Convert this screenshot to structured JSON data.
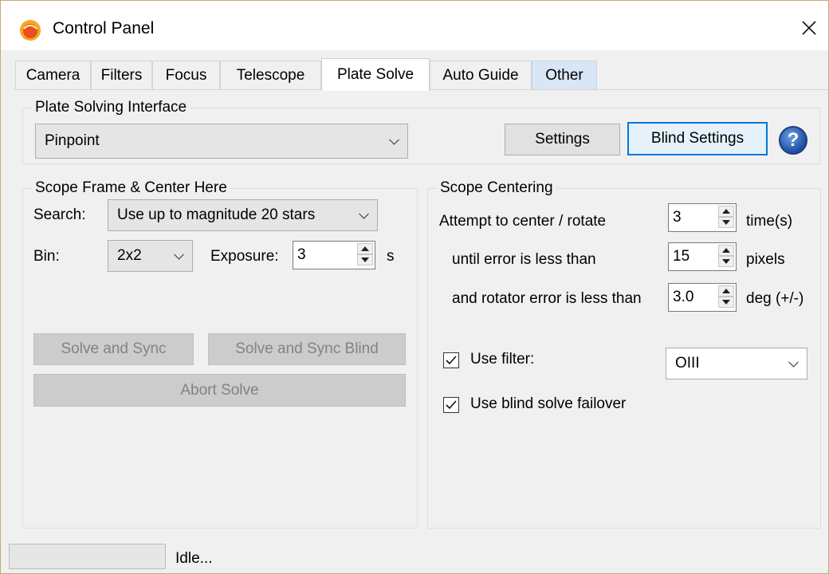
{
  "window": {
    "title": "Control Panel"
  },
  "tabs": [
    {
      "label": "Camera"
    },
    {
      "label": "Filters"
    },
    {
      "label": "Focus"
    },
    {
      "label": "Telescope"
    },
    {
      "label": "Plate Solve"
    },
    {
      "label": "Auto Guide"
    },
    {
      "label": "Other"
    }
  ],
  "active_tab": "Plate Solve",
  "interface": {
    "group_title": "Plate Solving Interface",
    "selected": "Pinpoint",
    "settings_label": "Settings",
    "blind_settings_label": "Blind Settings",
    "help_glyph": "?"
  },
  "scope_frame": {
    "group_title": "Scope Frame & Center Here",
    "search_label": "Search:",
    "search_value": "Use up to magnitude 20 stars",
    "bin_label": "Bin:",
    "bin_value": "2x2",
    "exposure_label": "Exposure:",
    "exposure_value": "3",
    "exposure_unit": "s",
    "solve_sync_label": "Solve and Sync",
    "solve_sync_blind_label": "Solve and Sync Blind",
    "abort_label": "Abort Solve"
  },
  "centering": {
    "group_title": "Scope Centering",
    "attempt_label": "Attempt to center / rotate",
    "attempt_value": "3",
    "attempt_unit": "time(s)",
    "error_label": "until error is less than",
    "error_value": "15",
    "error_unit": "pixels",
    "rot_label": "and rotator error is less than",
    "rot_value": "3.0",
    "rot_unit": "deg (+/-)",
    "use_filter_label": "Use filter:",
    "use_filter_checked": true,
    "filter_value": "OIII",
    "failover_label": "Use blind solve failover",
    "failover_checked": true
  },
  "status": {
    "text": "Idle...",
    "progress": 0
  },
  "icons": {
    "app": "sun-icon",
    "close": "close-icon",
    "help": "help-icon"
  },
  "colors": {
    "accent": "#0078d7",
    "help_blue": "#1e4fa3",
    "tab_highlight": "#d8e6f5"
  }
}
